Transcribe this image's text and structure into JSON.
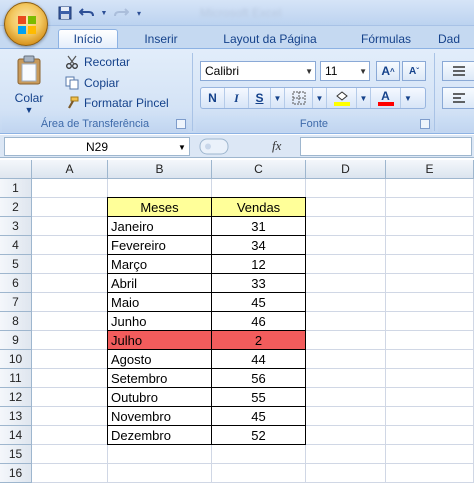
{
  "titlebar": {
    "title": "Microsoft Excel"
  },
  "tabs": [
    {
      "label": "Início",
      "active": true
    },
    {
      "label": "Inserir",
      "active": false
    },
    {
      "label": "Layout da Página",
      "active": false
    },
    {
      "label": "Fórmulas",
      "active": false
    },
    {
      "label": "Dad",
      "active": false
    }
  ],
  "clipboard": {
    "paste_label": "Colar",
    "cut_label": "Recortar",
    "copy_label": "Copiar",
    "format_painter_label": "Formatar Pincel",
    "group_label": "Área de Transferência"
  },
  "font": {
    "font_name": "Calibri",
    "font_size": "11",
    "bold_label": "N",
    "italic_label": "I",
    "underline_label": "S",
    "grow_label": "A",
    "shrink_label": "A",
    "group_label": "Fonte",
    "highlight_color": "#ffff00",
    "font_color": "#ff0000"
  },
  "formula_bar": {
    "name_box": "N29",
    "fx_label": "fx",
    "formula": ""
  },
  "grid": {
    "columns": [
      "A",
      "B",
      "C",
      "D",
      "E"
    ],
    "rows": [
      "1",
      "2",
      "3",
      "4",
      "5",
      "6",
      "7",
      "8",
      "9",
      "10",
      "11",
      "12",
      "13",
      "14",
      "15",
      "16"
    ],
    "header": {
      "b": "Meses",
      "c": "Vendas"
    },
    "header_fill": "#ffff99",
    "highlight_fill": "#f25c5c",
    "data": [
      {
        "mes": "Janeiro",
        "vendas": "31",
        "highlight": false
      },
      {
        "mes": "Fevereiro",
        "vendas": "34",
        "highlight": false
      },
      {
        "mes": "Março",
        "vendas": "12",
        "highlight": false
      },
      {
        "mes": "Abril",
        "vendas": "33",
        "highlight": false
      },
      {
        "mes": "Maio",
        "vendas": "45",
        "highlight": false
      },
      {
        "mes": "Junho",
        "vendas": "46",
        "highlight": false
      },
      {
        "mes": "Julho",
        "vendas": "2",
        "highlight": true
      },
      {
        "mes": "Agosto",
        "vendas": "44",
        "highlight": false
      },
      {
        "mes": "Setembro",
        "vendas": "56",
        "highlight": false
      },
      {
        "mes": "Outubro",
        "vendas": "55",
        "highlight": false
      },
      {
        "mes": "Novembro",
        "vendas": "45",
        "highlight": false
      },
      {
        "mes": "Dezembro",
        "vendas": "52",
        "highlight": false
      }
    ]
  }
}
